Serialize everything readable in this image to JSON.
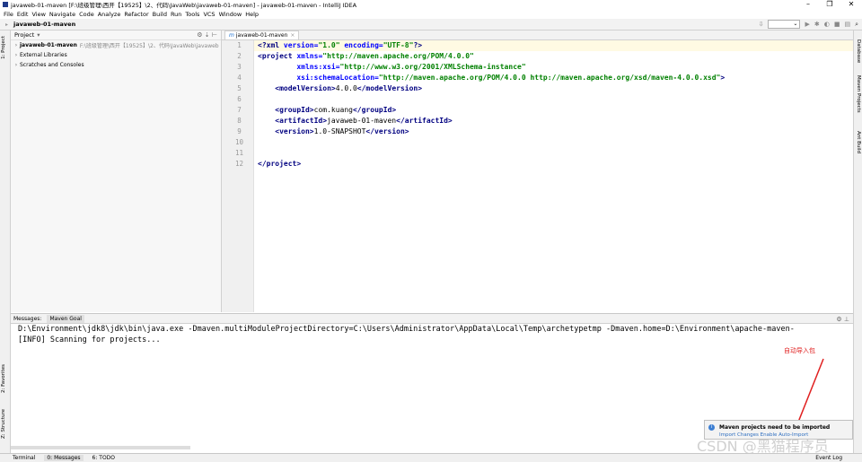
{
  "window": {
    "title": "javaweb-01-maven [F:\\班级管理\\西开【19525】\\2、代码\\JavaWeb\\javaweb-01-maven] - javaweb-01-maven - IntelliJ IDEA",
    "controls": [
      "–",
      "❐",
      "✕"
    ]
  },
  "menu": [
    "File",
    "Edit",
    "View",
    "Navigate",
    "Code",
    "Analyze",
    "Refactor",
    "Build",
    "Run",
    "Tools",
    "VCS",
    "Window",
    "Help"
  ],
  "navbar": {
    "breadcrumb": "javaweb-01-maven"
  },
  "left_strip": {
    "project": "1: Project",
    "favorites": "2: Favorites",
    "structure": "Z: Structure"
  },
  "right_strip": {
    "database": "Database",
    "maven": "Maven Projects",
    "ant": "Ant Build"
  },
  "project_panel": {
    "header": "Project",
    "tree": [
      {
        "label": "javaweb-01-maven",
        "path": "F:\\班级管理\\西开【19525】\\2、代码\\JavaWeb\\javaweb",
        "bold": true
      },
      {
        "label": "External Libraries",
        "path": "",
        "bold": false
      },
      {
        "label": "Scratches and Consoles",
        "path": "",
        "bold": false
      }
    ]
  },
  "editor": {
    "tab": "javaweb-01-maven",
    "line_numbers": [
      "1",
      "2",
      "3",
      "4",
      "5",
      "6",
      "7",
      "8",
      "9",
      "10",
      "11",
      "12"
    ]
  },
  "bottom": {
    "tabs": [
      "Messages:",
      "Maven Goal"
    ],
    "lines": [
      "D:\\Environment\\jdk8\\jdk\\bin\\java.exe -Dmaven.multiModuleProjectDirectory=C:\\Users\\Administrator\\AppData\\Local\\Temp\\archetypetmp -Dmaven.home=D:\\Environment\\apache-maven-",
      "[INFO] Scanning for projects..."
    ]
  },
  "status": {
    "terminal": "Terminal",
    "messages": "0: Messages",
    "todo": "6: TODO",
    "event_log": "Event Log"
  },
  "popup": {
    "title": "Maven projects need to be imported",
    "link": "Import Changes   Enable Auto-Import"
  },
  "annotation": "自动导入包",
  "watermark": "CSDN @黑猫程序员",
  "colors": {
    "tag": "#000080",
    "attr": "#0000ff",
    "value": "#008000",
    "annotation": "#e02020"
  }
}
